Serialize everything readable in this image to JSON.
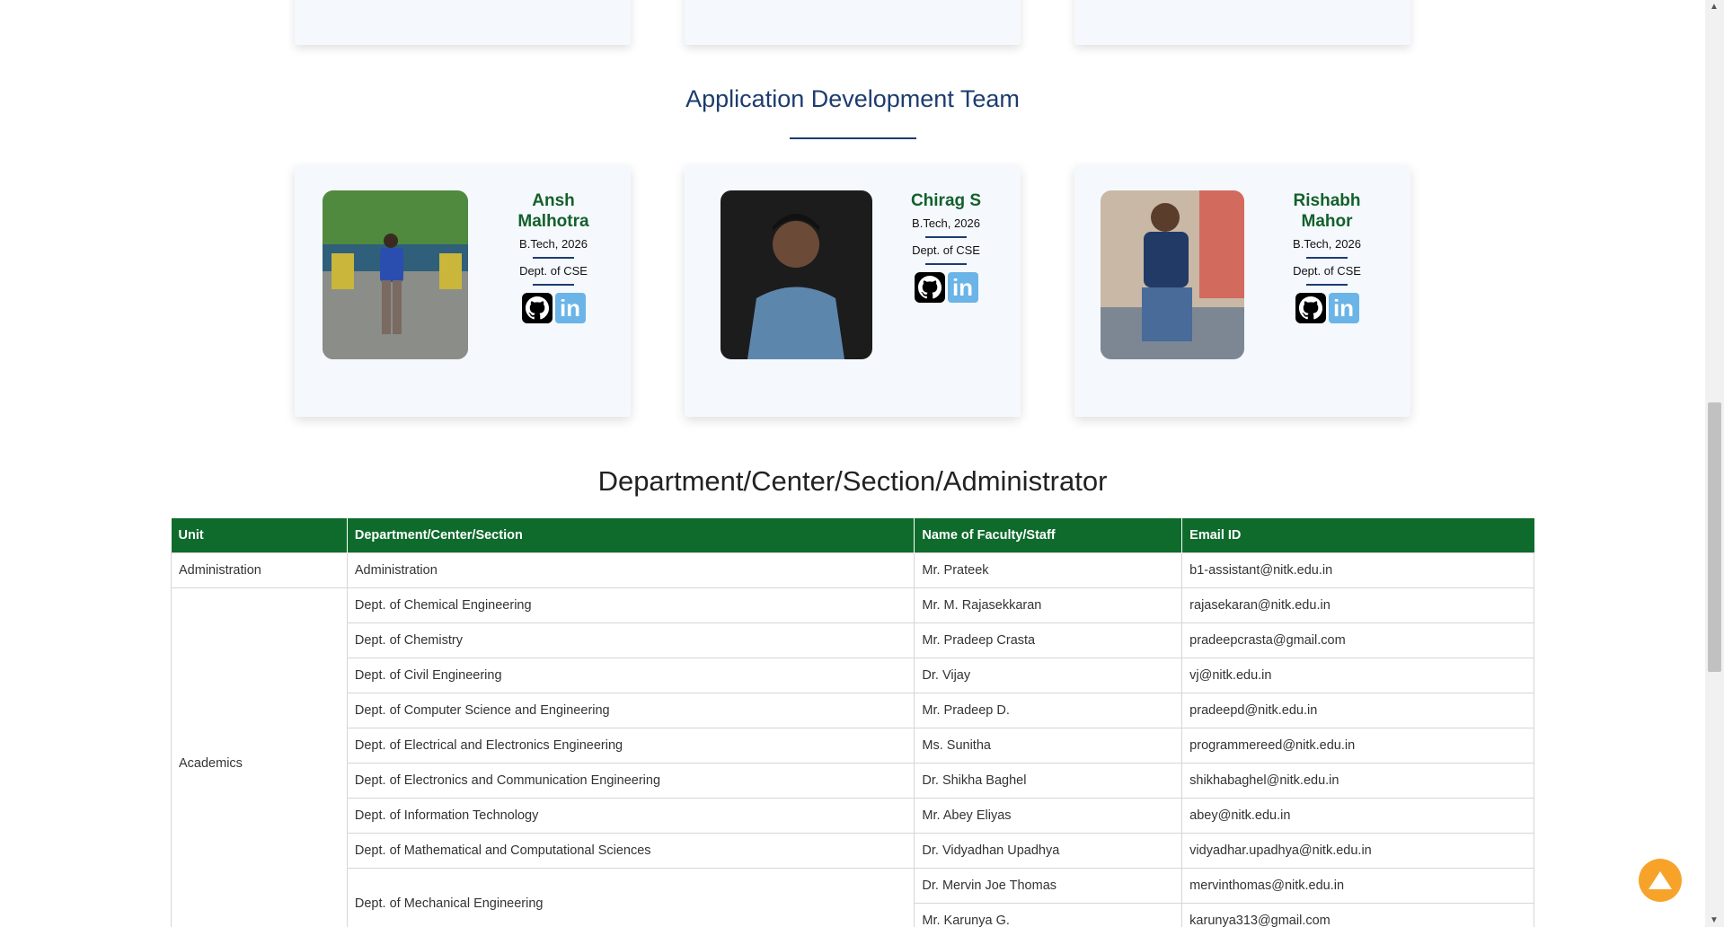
{
  "team": {
    "heading": "Application Development Team",
    "members": [
      {
        "name": "Ansh Malhotra",
        "program": "B.Tech, 2026",
        "dept": "Dept. of CSE",
        "icons": [
          "github-icon",
          "linkedin-icon"
        ]
      },
      {
        "name": "Chirag S",
        "program": "B.Tech, 2026",
        "dept": "Dept. of CSE",
        "icons": [
          "github-icon",
          "linkedin-icon"
        ]
      },
      {
        "name": "Rishabh Mahor",
        "program": "B.Tech, 2026",
        "dept": "Dept. of CSE",
        "icons": [
          "github-icon",
          "linkedin-icon"
        ]
      }
    ],
    "linkedin_label": "in"
  },
  "directory": {
    "heading": "Department/Center/Section/Administrator",
    "columns": [
      "Unit",
      "Department/Center/Section",
      "Name of Faculty/Staff",
      "Email ID"
    ],
    "rows": [
      {
        "unit": "Administration",
        "dept": "Administration",
        "name": "Mr. Prateek",
        "email": "b1-assistant@nitk.edu.in"
      },
      {
        "unit": "Academics",
        "dept": "Dept. of Chemical Engineering",
        "name": "Mr. M. Rajasekkaran",
        "email": "rajasekaran@nitk.edu.in"
      },
      {
        "unit": "",
        "dept": "Dept. of Chemistry",
        "name": "Mr. Pradeep Crasta",
        "email": "pradeepcrasta@gmail.com"
      },
      {
        "unit": "",
        "dept": "Dept. of Civil Engineering",
        "name": "Dr. Vijay",
        "email": "vj@nitk.edu.in"
      },
      {
        "unit": "",
        "dept": "Dept. of Computer Science and Engineering",
        "name": "Mr. Pradeep D.",
        "email": "pradeepd@nitk.edu.in"
      },
      {
        "unit": "",
        "dept": "Dept. of Electrical and Electronics Engineering",
        "name": "Ms. Sunitha",
        "email": "programmereed@nitk.edu.in"
      },
      {
        "unit": "",
        "dept": "Dept. of Electronics and Communication Engineering",
        "name": "Dr. Shikha Baghel",
        "email": "shikhabaghel@nitk.edu.in"
      },
      {
        "unit": "",
        "dept": "Dept. of Information Technology",
        "name": "Mr. Abey Eliyas",
        "email": "abey@nitk.edu.in"
      },
      {
        "unit": "",
        "dept": "Dept. of Mathematical and Computational Sciences",
        "name": "Dr. Vidyadhan Upadhya",
        "email": "vidyadhar.upadhya@nitk.edu.in"
      },
      {
        "unit": "",
        "dept": "Dept. of Mechanical Engineering",
        "name": "Dr. Mervin Joe Thomas",
        "email": "mervinthomas@nitk.edu.in"
      },
      {
        "unit": "",
        "dept": "",
        "name": "Mr. Karunya G.",
        "email": "karunya313@gmail.com"
      }
    ]
  },
  "colors": {
    "heading_blue": "#1d3c6e",
    "name_green": "#14602c",
    "table_header_green": "#0e6b2c",
    "back_to_top_orange": "#f7a32a"
  }
}
